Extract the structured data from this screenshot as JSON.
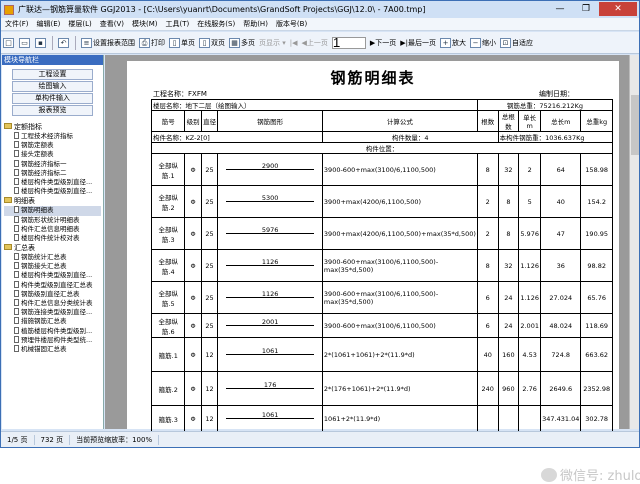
{
  "window": {
    "title": "广联达—钢筋算量软件 GGJ2013 - [C:\\Users\\yuanrt\\Documents\\GrandSoft Projects\\GGJ\\12.0\\ - 7A00.tmp]"
  },
  "menu": [
    "文件(F)",
    "编辑(E)",
    "楼层(L)",
    "查看(V)",
    "模块(M)",
    "工具(T)",
    "在线服务(S)",
    "帮助(H)",
    "版本号(B)"
  ],
  "toolbar": {
    "setting_label": "设置报表范围",
    "print_label": "打印",
    "single_label": "单页",
    "double_label": "双页",
    "multi_label": "多页",
    "pageview_label": "页显示 ▾",
    "prev_label": "上一页",
    "page_value": "1",
    "next_label": "下一页",
    "last_label": "最后一页",
    "zoomin_label": "放大",
    "zoomout_label": "缩小",
    "fit_label": "自适应"
  },
  "left": {
    "title": "模块导航栏",
    "tabs": [
      "工程设置",
      "绘图输入",
      "单构件输入",
      "报表预览"
    ],
    "groups": [
      {
        "label": "定额指标",
        "items": [
          "工程技术经济指标",
          "钢筋定额表",
          "接头定额表",
          "钢筋经济指标一",
          "钢筋经济指标二",
          "楼层构件类型级别直径...",
          "楼层构件类型级别直径..."
        ]
      },
      {
        "label": "明细表",
        "items": [
          "钢筋明细表",
          "钢筋形状统计明细表",
          "构件汇总信息明细表",
          "楼层构件统计校对表"
        ]
      },
      {
        "label": "汇总表",
        "items": [
          "钢筋统计汇总表",
          "钢筋接头汇总表",
          "楼层构件类型级别直径...",
          "构件类型级别直径汇总表",
          "钢筋级别直径汇总表",
          "构件汇总信息分类统计表",
          "钢筋连接类型级别直径...",
          "措施钢筋汇总表",
          "植筋楼层构件类型级别...",
          "预埋件楼层构件类型统...",
          "机械锚固汇总表"
        ]
      }
    ],
    "selected_item": "钢筋明细表"
  },
  "report": {
    "title": "钢筋明细表",
    "project_label": "工程名称：",
    "project_value": "FXFM",
    "maker_label": "编制日期：",
    "floor_label": "楼层名称：地下二层（绘图输入）",
    "total_label": "钢筋总重：75216.212Kg",
    "headers": [
      "筋号",
      "级别",
      "直径",
      "钢筋图形",
      "计算公式",
      "根数",
      "总根数",
      "单长m",
      "总长m",
      "总重kg"
    ],
    "component_name": "构件名称：KZ-2[0]",
    "component_count": "构件数量：4",
    "component_weight": "本构件钢筋重：1036.637Kg",
    "position": "构件位置：",
    "rows": [
      {
        "name": "全部纵筋.1",
        "grade": "Φ",
        "dia": "25",
        "shape": "2900",
        "formula": "3900-600+max(3100/6,1100,500)",
        "n": "8",
        "total": "32",
        "unit": "2",
        "len": "64",
        "wt": "158.98"
      },
      {
        "name": "全部纵筋.2",
        "grade": "Φ",
        "dia": "25",
        "shape": "5300",
        "formula": "3900+max(4200/6,1100,500)",
        "n": "2",
        "total": "8",
        "unit": "5",
        "len": "40",
        "wt": "154.2"
      },
      {
        "name": "全部纵筋.3",
        "grade": "Φ",
        "dia": "25",
        "shape": "5976",
        "formula": "3900+max(4200/6,1100,500)+max(35*d,500)",
        "n": "2",
        "total": "8",
        "unit": "5.976",
        "len": "47",
        "wt": "190.95"
      },
      {
        "name": "全部纵筋.4",
        "grade": "Φ",
        "dia": "25",
        "shape": "1126",
        "formula": "3900-600+max(3100/6,1100,500)-max(35*d,500)",
        "n": "8",
        "total": "32",
        "unit": "1.126",
        "len": "36",
        "wt": "98.82"
      },
      {
        "name": "全部纵筋.5",
        "grade": "Φ",
        "dia": "25",
        "shape": "1126",
        "formula": "3900-600+max(3100/6,1100,500)-max(35*d,500)",
        "n": "6",
        "total": "24",
        "unit": "1.126",
        "len": "27.024",
        "wt": "65.76"
      },
      {
        "name": "全部纵筋.6",
        "grade": "Φ",
        "dia": "25",
        "shape": "2001",
        "formula": "3900-600+max(3100/6,1100,500)",
        "n": "6",
        "total": "24",
        "unit": "2.001",
        "len": "48.024",
        "wt": "118.69"
      },
      {
        "name": "箍筋.1",
        "grade": "Φ",
        "dia": "12",
        "shape": "1061",
        "formula": "2*(1061+1061)+2*(11.9*d)",
        "n": "40",
        "total": "160",
        "unit": "4.53",
        "len": "724.8",
        "wt": "663.62"
      },
      {
        "name": "箍筋.2",
        "grade": "Φ",
        "dia": "12",
        "shape": "176",
        "formula": "2*(176+1061)+2*(11.9*d)",
        "n": "240",
        "total": "960",
        "unit": "2.76",
        "len": "2649.6",
        "wt": "2352.98"
      },
      {
        "name": "箍筋.3",
        "grade": "Φ",
        "dia": "12",
        "shape": "1061",
        "formula": "1061+2*(11.9*d)",
        "n": "",
        "total": "",
        "unit": "",
        "len": "347.431.04",
        "wt": "302.78"
      }
    ]
  },
  "status": {
    "page": "1/5 页",
    "pages_total": "732 页",
    "zoom": "当前预览缩放率：100%"
  },
  "watermark": "微信号: zhulong"
}
